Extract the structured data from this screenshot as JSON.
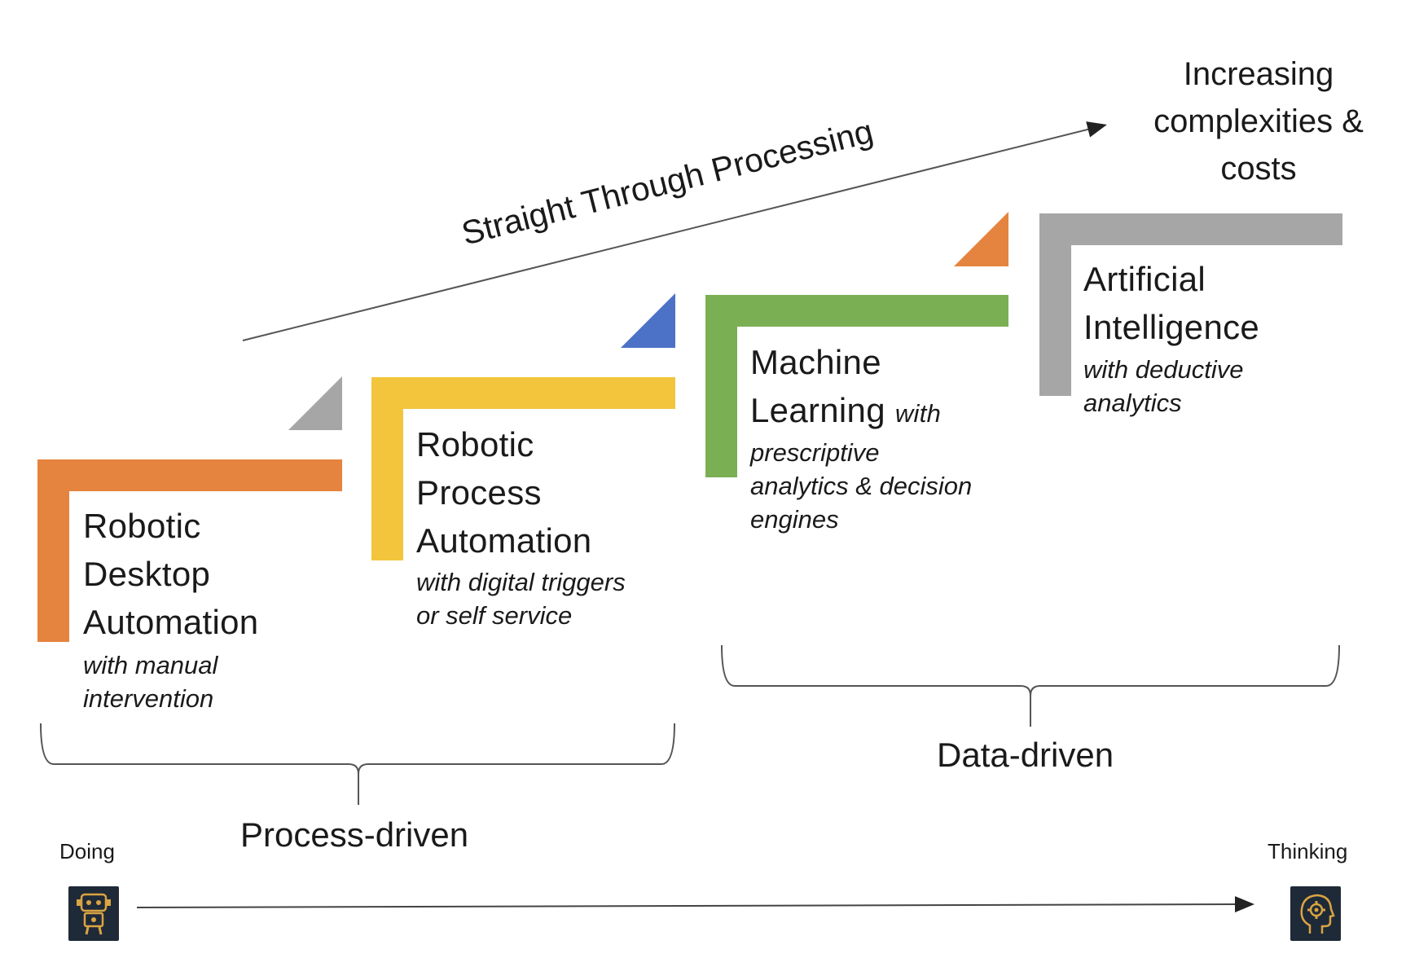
{
  "colors": {
    "step1": "#E4843F",
    "step2": "#F2C53D",
    "step3": "#7BAF54",
    "step4": "#A6A6A6",
    "tri1": "#A6A6A6",
    "tri2": "#4C72C8",
    "tri3": "#E4843F",
    "line": "#333333",
    "icon_bg": "#1f2a38",
    "icon_fg": "#d9a441"
  },
  "straight_through": "Straight Through Processing",
  "top_right": [
    "Increasing",
    "complexities &",
    "costs"
  ],
  "steps": [
    {
      "title_lines": [
        "Robotic",
        "Desktop",
        "Automation"
      ],
      "sub_lines": [
        "with manual",
        "intervention"
      ]
    },
    {
      "title_lines": [
        "Robotic",
        "Process",
        "Automation"
      ],
      "sub_lines": [
        "with digital triggers",
        "or self service"
      ]
    },
    {
      "title_lines": [
        "Machine",
        "Learning"
      ],
      "inline_sub": "with",
      "sub_lines": [
        "prescriptive",
        "analytics & decision",
        "engines"
      ]
    },
    {
      "title_lines": [
        "Artificial",
        "Intelligence"
      ],
      "sub_lines": [
        "with deductive",
        "analytics"
      ]
    }
  ],
  "groups": {
    "process": "Process-driven",
    "data": "Data-driven"
  },
  "axis": {
    "left": "Doing",
    "right": "Thinking",
    "left_icon": "robot-icon",
    "right_icon": "head-gear-icon"
  }
}
